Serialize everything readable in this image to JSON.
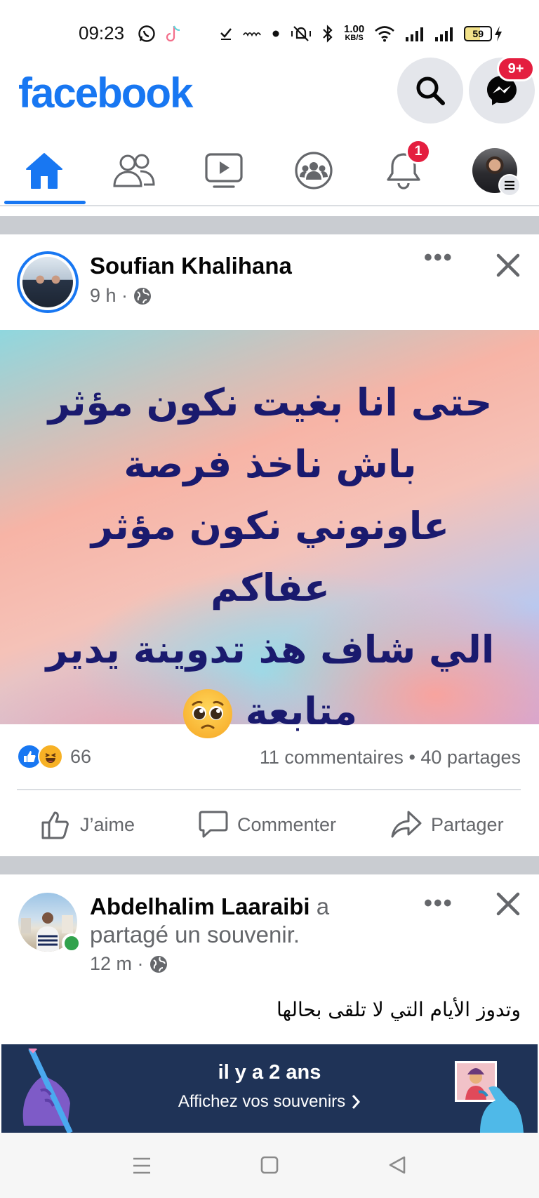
{
  "status_bar": {
    "time": "09:23",
    "net_speed_value": "1.00",
    "net_speed_unit": "KB/S",
    "battery": "59"
  },
  "header": {
    "logo": "facebook",
    "messenger_badge": "9+"
  },
  "nav": {
    "notification_badge": "1"
  },
  "post1": {
    "author": "Soufian Khalihana",
    "time": "9 h ·",
    "lines": [
      "حتى انا بغيت نكون مؤثر",
      "باش ناخذ فرصة",
      "عاونوني نكون مؤثر عفاكم",
      "الي شاف هذ تدوينة يدير",
      "متابعة"
    ],
    "reactions_count": "66",
    "comments": "11 commentaires",
    "shares": "• 40 partages",
    "like_label": "J’aime",
    "comment_label": "Commenter",
    "share_label": "Partager"
  },
  "post2": {
    "author": "Abdelhalim Laaraibi",
    "action_suffix": "a",
    "action_line2": "partagé un souvenir.",
    "time": "12 m ·",
    "text": "وتدوز الأيام التي لا تلقى بحالها",
    "memory_title": "il y a 2 ans",
    "memory_link": "Affichez vos souvenirs"
  },
  "colors": {
    "brand": "#1877f2",
    "badge": "#e41e3f",
    "memory_bg": "#1f3357",
    "online": "#31a24c"
  }
}
